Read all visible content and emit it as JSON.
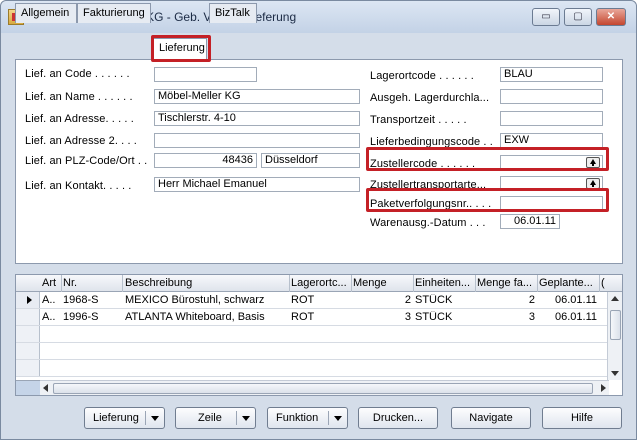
{
  "window": {
    "title": "102001 Möbel-Meller KG - Geb. Verkaufslieferung",
    "minimize_label": "▭",
    "maximize_label": "▢",
    "close_label": "✕",
    "app_icon": "window-app-icon"
  },
  "tabs": [
    {
      "label": "Allgemein",
      "active": false
    },
    {
      "label": "Fakturierung",
      "active": false
    },
    {
      "label": "Lieferung",
      "active": true
    },
    {
      "label": "BizTalk",
      "active": false
    }
  ],
  "highlight_color": "#c42026",
  "left_fields": {
    "code": {
      "label": "Lief. an Code . . . . . .",
      "value": ""
    },
    "name": {
      "label": "Lief. an Name . . . . . .",
      "value": "Möbel-Meller KG"
    },
    "adresse": {
      "label": "Lief. an Adresse. . . . .",
      "value": "Tischlerstr. 4-10"
    },
    "adresse2": {
      "label": "Lief. an Adresse 2. . . .",
      "value": ""
    },
    "plz_ort": {
      "label": "Lief. an PLZ-Code/Ort . .",
      "plz": "48436",
      "ort": "Düsseldorf"
    },
    "kontakt": {
      "label": "Lief. an Kontakt. . . . .",
      "value": "Herr Michael Emanuel"
    }
  },
  "right_fields": {
    "lagerortcode": {
      "label": "Lagerortcode . . . . . .",
      "value": "BLAU"
    },
    "lagerdurchlauf": {
      "label": "Ausgeh. Lagerdurchla...",
      "value": ""
    },
    "transportzeit": {
      "label": "Transportzeit . . . . .",
      "value": ""
    },
    "lieferbedingung": {
      "label": "Lieferbedingungscode . .",
      "value": "EXW"
    },
    "zustellercode": {
      "label": "Zustellercode . . . . . .",
      "value": "",
      "lookup_icon": "lookup-arrow-icon"
    },
    "zustellertransport": {
      "label": "Zustellertransportarte...",
      "value": "",
      "lookup_icon": "lookup-arrow-icon"
    },
    "paketverfolgung": {
      "label": "Paketverfolgungsnr.. . . .",
      "value": ""
    },
    "warenausgang": {
      "label": "Warenausg.-Datum . . .",
      "value": "06.01.11"
    }
  },
  "lines": {
    "columns": [
      "Art",
      "Nr.",
      "Beschreibung",
      "Lagerortc...",
      "Menge",
      "Einheiten...",
      "Menge fa...",
      "Geplante...",
      "("
    ],
    "rows": [
      {
        "art": "A..",
        "nr": "1968-S",
        "beschreibung": "MEXICO Bürostuhl, schwarz",
        "lagerort": "ROT",
        "menge": "2",
        "einheit": "STÜCK",
        "menge_fa": "2",
        "geplant": "06.01.11"
      },
      {
        "art": "A..",
        "nr": "1996-S",
        "beschreibung": "ATLANTA Whiteboard, Basis",
        "lagerort": "ROT",
        "menge": "3",
        "einheit": "STÜCK",
        "menge_fa": "3",
        "geplant": "06.01.11"
      }
    ]
  },
  "buttons": {
    "lieferung": "Lieferung",
    "zeile": "Zeile",
    "funktion": "Funktion",
    "drucken": "Drucken...",
    "navigate": "Navigate",
    "hilfe": "Hilfe"
  }
}
